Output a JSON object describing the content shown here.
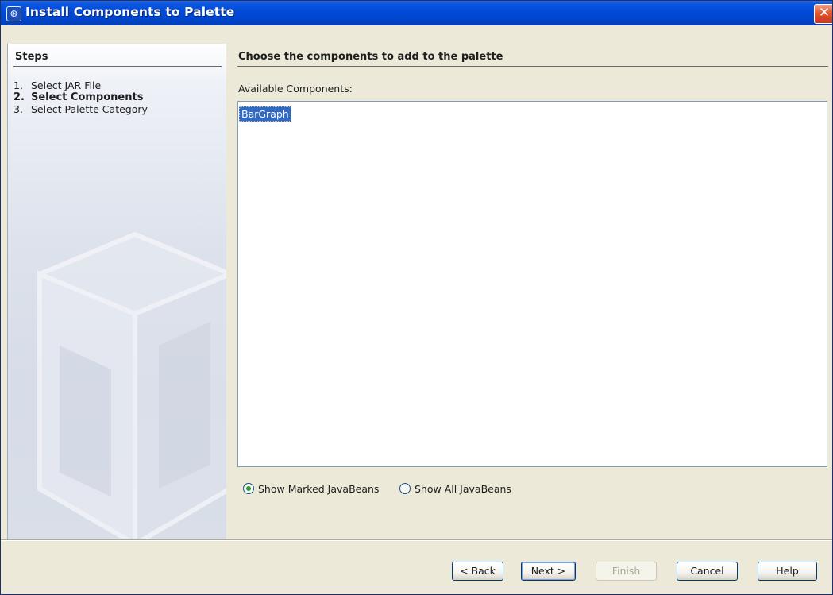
{
  "window": {
    "title": "Install Components to Palette"
  },
  "steps": {
    "heading": "Steps",
    "items": [
      {
        "num": "1.",
        "label": "Select JAR File"
      },
      {
        "num": "2.",
        "label": "Select Components"
      },
      {
        "num": "3.",
        "label": "Select Palette Category"
      }
    ]
  },
  "main": {
    "heading": "Choose the components to add to the palette",
    "list_label": "Available Components:",
    "components": [
      "BarGraph"
    ],
    "radio_options": [
      {
        "label": "Show Marked JavaBeans",
        "selected": true
      },
      {
        "label": "Show All JavaBeans",
        "selected": false
      }
    ]
  },
  "buttons": {
    "back": "< Back",
    "next": "Next >",
    "finish": "Finish",
    "cancel": "Cancel",
    "help": "Help"
  },
  "icons": {
    "app": "netbeans-cube-icon",
    "close": "close-icon"
  },
  "colors": {
    "titlebar": "#0049d6",
    "selection": "#316ac5",
    "close": "#e2582c"
  }
}
